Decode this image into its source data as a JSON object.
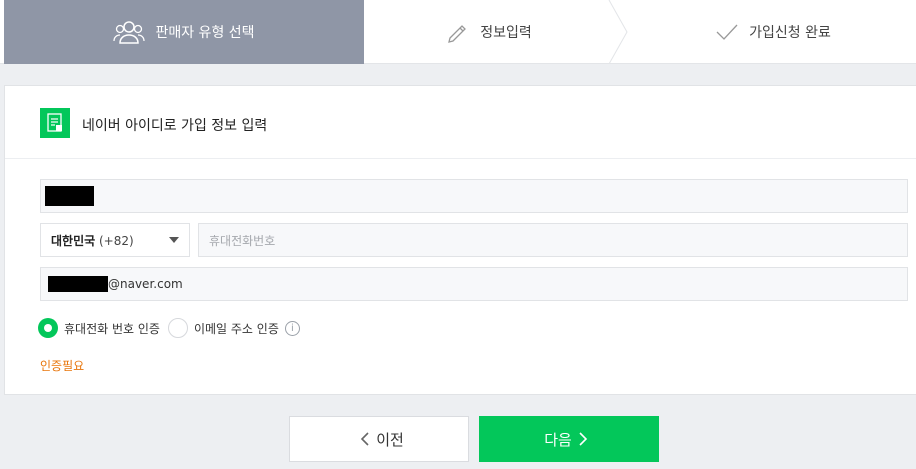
{
  "steps": [
    {
      "label": "판매자 유형 선택",
      "icon": "users-icon",
      "active": true
    },
    {
      "label": "정보입력",
      "icon": "pencil-icon",
      "active": false
    },
    {
      "label": "가입신청 완료",
      "icon": "check-icon",
      "active": false
    }
  ],
  "card": {
    "title": "네이버 아이디로 가입 정보 입력",
    "badge_icon": "document-icon"
  },
  "form": {
    "country": {
      "name": "대한민국",
      "code": "(+82)"
    },
    "phone_placeholder": "휴대전화번호",
    "email_domain": "@naver.com"
  },
  "verify": {
    "options": [
      {
        "label": "휴대전화 번호 인증",
        "selected": true
      },
      {
        "label": "이메일 주소 인증",
        "selected": false
      }
    ],
    "info_icon": "info-icon",
    "status": "인증필요"
  },
  "buttons": {
    "prev": "이전",
    "next": "다음"
  },
  "colors": {
    "accent": "#03c75a",
    "active_step": "#8f96a6",
    "warning": "#e8750a"
  }
}
